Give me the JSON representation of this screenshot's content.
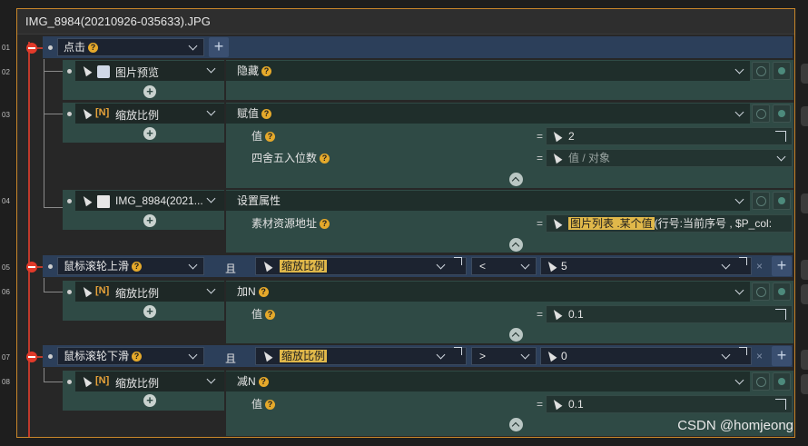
{
  "window_title": "IMG_8984(20210926-035633).JPG",
  "line_numbers": [
    "01",
    "02",
    "03",
    "04",
    "05",
    "06",
    "07",
    "08"
  ],
  "rows": {
    "r01": {
      "event": "点击"
    },
    "r02": {
      "target": "图片预览",
      "prop": "隐藏"
    },
    "r03": {
      "target": "缩放比例",
      "prop": "赋值",
      "params": [
        {
          "label": "值",
          "value": "2"
        },
        {
          "label": "四舍五入位数",
          "placeholder": "值 / 对象"
        }
      ]
    },
    "r04": {
      "target": "IMG_8984(2021...",
      "prop": "设置属性",
      "param_label": "素材资源地址",
      "param_value_hl": "图片列表 .某个值",
      "param_value_rest": "(行号:当前序号 , $P_col:"
    },
    "r05": {
      "event": "鼠标滚轮上滑",
      "cond_and": "且",
      "cond_target": "缩放比例",
      "cond_op": "<",
      "cond_value": "5"
    },
    "r06": {
      "target": "缩放比例",
      "prop": "加N",
      "param_label": "值",
      "param_value": "0.1"
    },
    "r07": {
      "event": "鼠标滚轮下滑",
      "cond_and": "且",
      "cond_target": "缩放比例",
      "cond_op": ">",
      "cond_value": "0"
    },
    "r08": {
      "target": "缩放比例",
      "prop": "减N",
      "param_label": "值",
      "param_value": "0.1"
    }
  },
  "symbols": {
    "equals": "=",
    "plus": "+",
    "close": "×",
    "help": "?",
    "number_tag": "[N]"
  },
  "watermark": "CSDN @homjeong",
  "colors": {
    "accent": "#c8862a",
    "trigger_bg": "#2c3f5a",
    "action_bg": "#2f4a45",
    "highlight": "#e0b84a",
    "help_badge": "#e5a92b",
    "breakpoint": "#e23a2a"
  },
  "icons": [
    "breakpoint-icon",
    "pointer-icon",
    "image-icon",
    "number-icon",
    "plus-icon",
    "chevron-down-icon",
    "expand-arrow-icon",
    "collapse-icon",
    "close-icon",
    "help-icon"
  ]
}
